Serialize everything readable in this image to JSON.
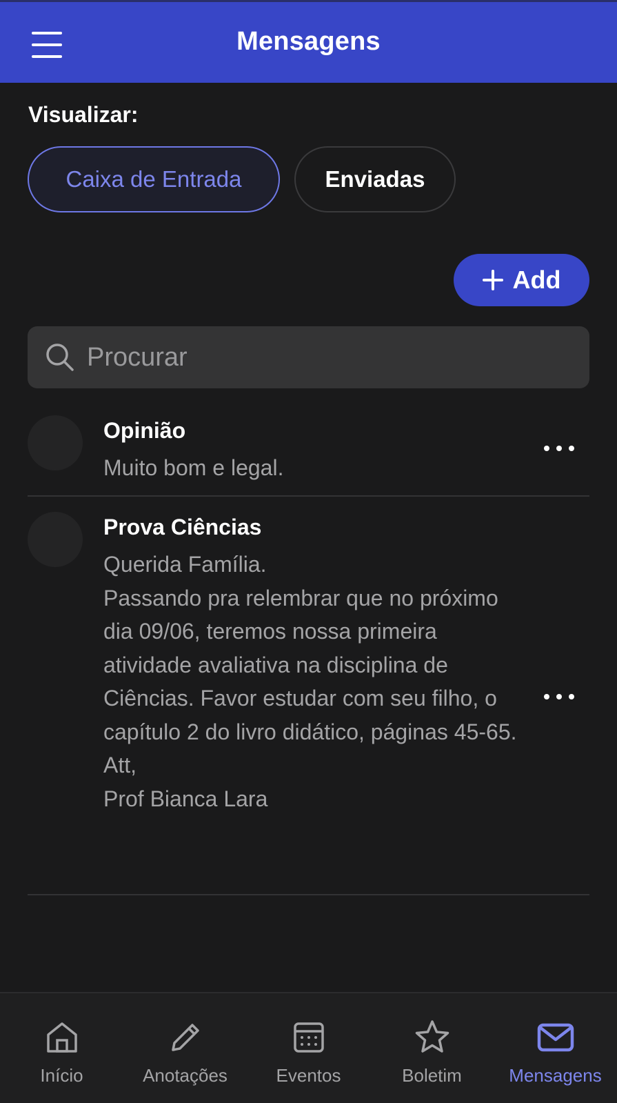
{
  "header": {
    "title": "Mensagens",
    "menu_icon": "hamburger-menu-icon"
  },
  "filter": {
    "label": "Visualizar:",
    "options": [
      {
        "label": "Caixa de Entrada",
        "selected": true
      },
      {
        "label": "Enviadas",
        "selected": false
      }
    ]
  },
  "add_button": {
    "label": "Add",
    "icon": "plus-icon"
  },
  "search": {
    "placeholder": "Procurar",
    "value": "",
    "icon": "search-icon"
  },
  "messages": [
    {
      "title": "Opinião",
      "body": "Muito bom e legal.",
      "more_icon": "more-horizontal-icon"
    },
    {
      "title": "Prova Ciências",
      "body": "Querida Família.\nPassando pra relembrar que no próximo dia 09/06, teremos nossa primeira atividade avaliativa na disciplina de Ciências. Favor estudar com seu filho, o capítulo 2 do livro didático, páginas 45-65.\nAtt,\nProf Bianca Lara",
      "more_icon": "more-horizontal-icon"
    }
  ],
  "bottom_nav": [
    {
      "label": "Início",
      "icon": "home-icon",
      "active": false
    },
    {
      "label": "Anotações",
      "icon": "pencil-icon",
      "active": false
    },
    {
      "label": "Eventos",
      "icon": "calendar-icon",
      "active": false
    },
    {
      "label": "Boletim",
      "icon": "star-icon",
      "active": false
    },
    {
      "label": "Mensagens",
      "icon": "mail-icon",
      "active": true
    }
  ],
  "colors": {
    "primary": "#3846c7",
    "accent_text": "#7d86ec",
    "background": "#1a1a1b",
    "surface": "#343435",
    "muted_text": "#a4a4a6"
  }
}
